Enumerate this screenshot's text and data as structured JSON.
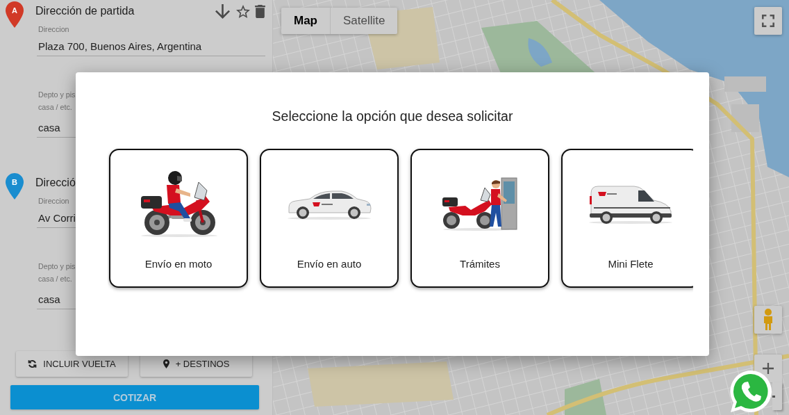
{
  "route_panel": {
    "stops": [
      {
        "kind": "origin",
        "marker": "A",
        "color": "#d13a27",
        "title": "Dirección de partida",
        "fields": [
          {
            "label": [
              "Direccion"
            ],
            "value": "Plaza 700, Buenos Aires, Argentina"
          },
          {
            "label": [
              "Depto y pis",
              "casa / etc."
            ],
            "value": "casa"
          }
        ]
      },
      {
        "kind": "destination",
        "marker": "B",
        "color": "#1a8dcf",
        "title": "Direcció",
        "fields": [
          {
            "label": [
              "Direccion"
            ],
            "value": "Av Corri"
          },
          {
            "label": [
              "Depto y pis",
              "casa / etc."
            ],
            "value": "casa"
          }
        ]
      }
    ],
    "actions": [
      {
        "kind": "return",
        "label": "INCLUIR VUELTA"
      },
      {
        "kind": "destinations",
        "label": "+ DESTINOS"
      }
    ],
    "submit": {
      "label": "COTIZAR"
    }
  },
  "map": {
    "map_type": [
      {
        "label": "Map",
        "selected": true
      },
      {
        "label": "Satellite",
        "selected": false
      }
    ]
  },
  "modal": {
    "title": "Seleccione la opción que desea solicitar",
    "options": [
      {
        "kind": "moto",
        "label": "Envío en moto"
      },
      {
        "kind": "auto",
        "label": "Envío en auto"
      },
      {
        "kind": "tramites",
        "label": "Trámites"
      },
      {
        "kind": "flete",
        "label": "Mini Flete"
      }
    ]
  }
}
